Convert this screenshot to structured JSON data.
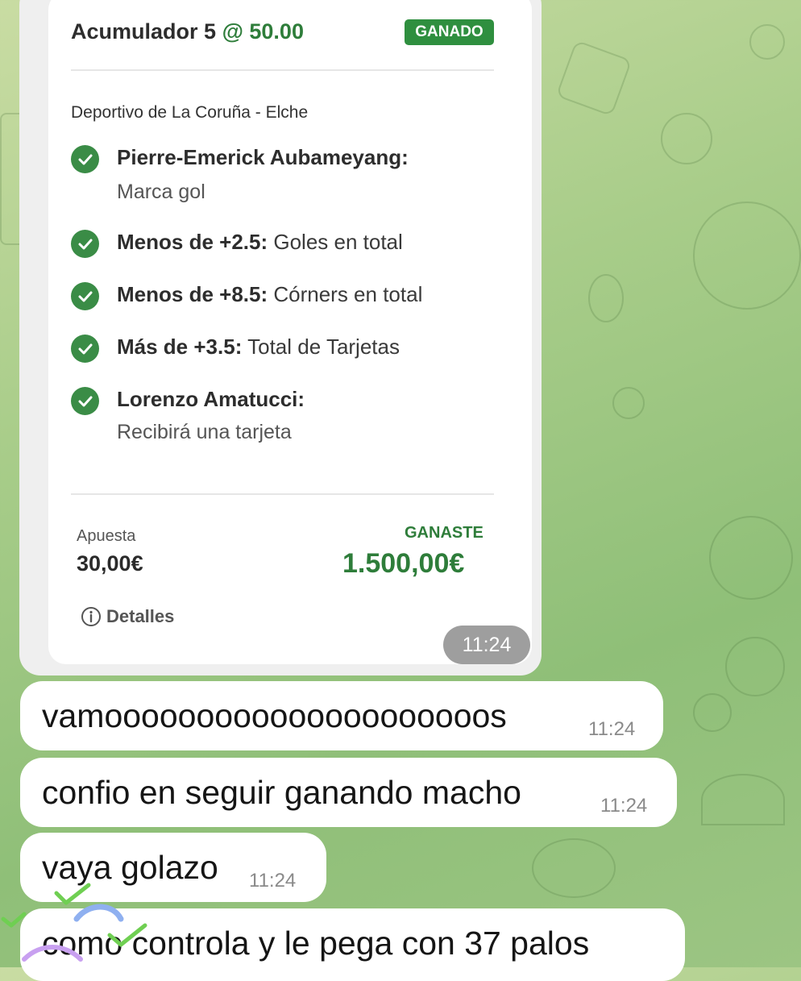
{
  "bet": {
    "title": "Acumulador 5",
    "odds": "@ 50.00",
    "status": "GANADO",
    "match": "Deportivo de La Coruña - Elche",
    "selections": [
      {
        "bold": "Pierre-Emerick Aubameyang:",
        "text": "Marca gol"
      },
      {
        "bold": "Menos de +2.5:",
        "text": "Goles en total"
      },
      {
        "bold": "Menos de +8.5:",
        "text": "Córners en total"
      },
      {
        "bold": "Más de +3.5:",
        "text": "Total de Tarjetas"
      },
      {
        "bold": "Lorenzo Amatucci:",
        "text": "Recibirá una tarjeta"
      }
    ],
    "stake_label": "Apuesta",
    "stake_value": "30,00€",
    "won_label": "GANASTE",
    "won_value": "1.500,00€",
    "details_label": "Detalles",
    "time": "11:24"
  },
  "messages": [
    {
      "text": "vamooooooooooooooooooooos",
      "time": "11:24"
    },
    {
      "text": "confio en seguir ganando macho",
      "time": "11:24"
    },
    {
      "text": "vaya golazo",
      "time": "11:24"
    },
    {
      "text": "como controla y le pega con 37 palos",
      "time": ""
    }
  ],
  "colors": {
    "accent": "#2e7d3a",
    "badge": "#2f8f3f",
    "check": "#3a8c46"
  }
}
